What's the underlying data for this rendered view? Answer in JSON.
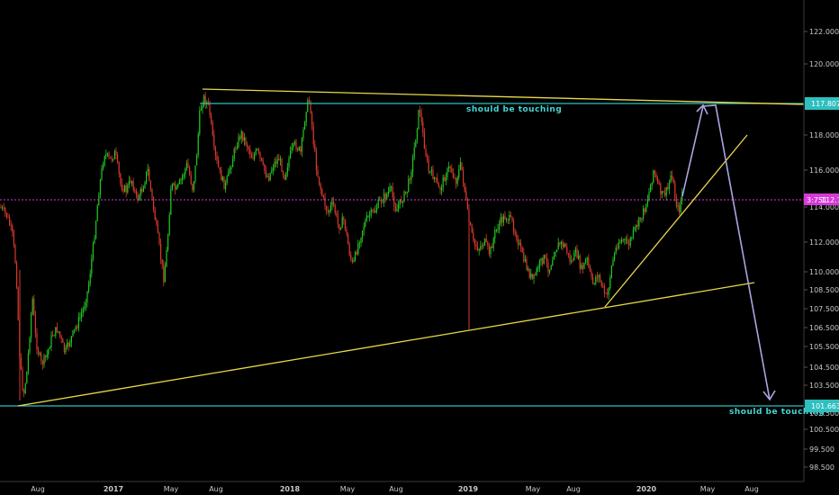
{
  "chart_data": {
    "type": "candlestick",
    "y_ticks": [
      "122.000",
      "120.000",
      "118.000",
      "116.000",
      "114.000",
      "112.000",
      "110.000",
      "108.500",
      "107.500",
      "106.500",
      "105.500",
      "104.500",
      "103.500",
      "102.500",
      "100.500",
      "99.500",
      "98.500"
    ],
    "x_ticks": [
      {
        "label": "Aug",
        "bold": false
      },
      {
        "label": "2017",
        "bold": true
      },
      {
        "label": "May",
        "bold": false
      },
      {
        "label": "Aug",
        "bold": false
      },
      {
        "label": "2018",
        "bold": true
      },
      {
        "label": "May",
        "bold": false
      },
      {
        "label": "Aug",
        "bold": false
      },
      {
        "label": "2019",
        "bold": true
      },
      {
        "label": "May",
        "bold": false
      },
      {
        "label": "Aug",
        "bold": false
      },
      {
        "label": "2020",
        "bold": true
      },
      {
        "label": "May",
        "bold": false
      },
      {
        "label": "Aug",
        "bold": false
      }
    ],
    "price_labels": {
      "upper": "117.807",
      "lower": "101.663",
      "current_left": "3:751",
      "current_right": "112.74"
    },
    "horizontal_levels": [
      {
        "value": 117.807,
        "color": "#2fbfbf"
      },
      {
        "value": 101.663,
        "color": "#2fbfbf"
      }
    ],
    "annotations": [
      {
        "text": "should be touching"
      },
      {
        "text": "should be touching"
      }
    ],
    "trendlines_color": "#e8d84a",
    "projection_color": "#a9a6e0",
    "up_color": "#22c722",
    "down_color": "#d93a2b",
    "current_price_color": "#d63ad6"
  }
}
